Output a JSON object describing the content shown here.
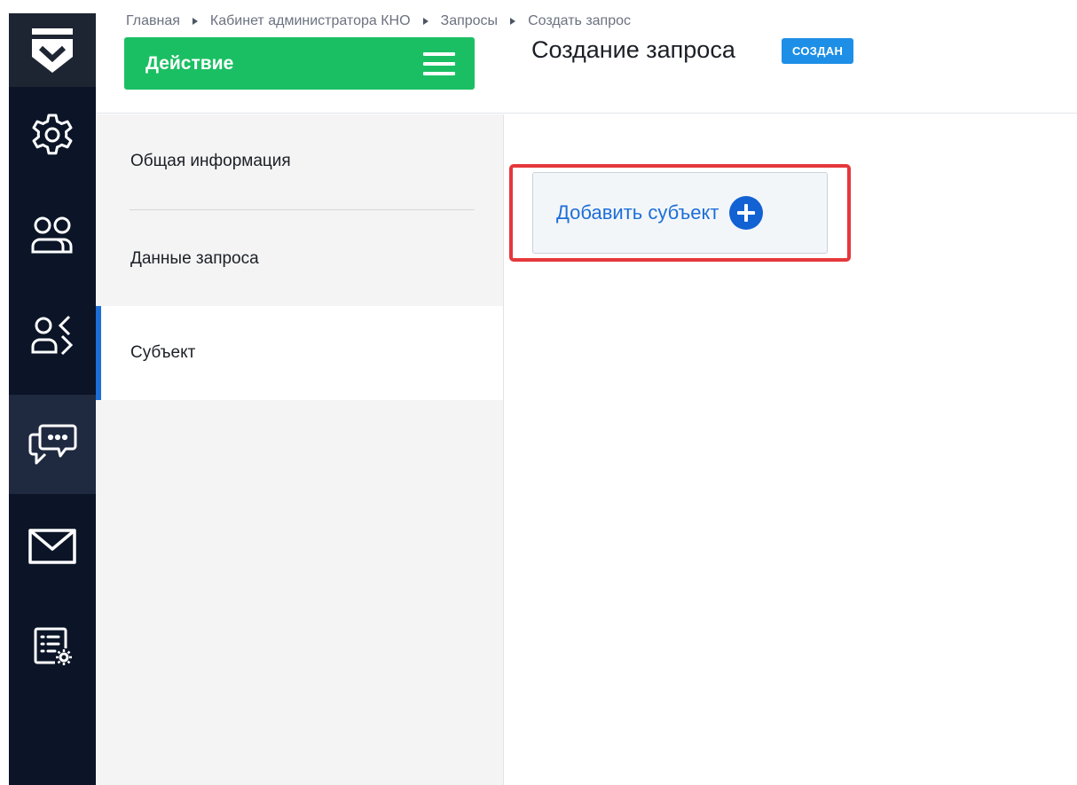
{
  "header": {
    "breadcrumb": [
      "Главная",
      "Кабинет администратора КНО",
      "Запросы",
      "Создать запрос"
    ],
    "action_label": "Действие",
    "page_title": "Создание запроса",
    "status": "СОЗДАН"
  },
  "rail": {
    "icons": [
      "logo-shield-icon",
      "gear-icon",
      "users-icon",
      "user-exchange-icon",
      "chat-icon",
      "mail-icon",
      "list-settings-icon"
    ],
    "active": "chat-icon"
  },
  "sections": [
    {
      "label": "Общая информация",
      "active": false
    },
    {
      "label": "Данные запроса",
      "active": false
    },
    {
      "label": "Субъект",
      "active": true
    }
  ],
  "main": {
    "add_subject_label": "Добавить субъект"
  },
  "colors": {
    "rail": "#0b1527",
    "action_green": "#1bbf63",
    "badge_blue": "#1d8fe6",
    "accent_blue": "#1d6fd8",
    "highlight_red": "#e5383b"
  }
}
